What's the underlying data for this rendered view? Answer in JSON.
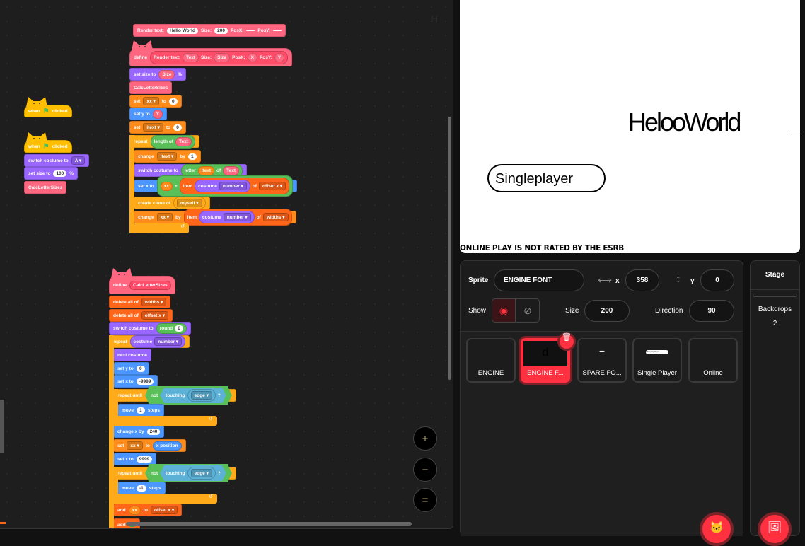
{
  "code": {
    "blocks": [
      {
        "c": "events",
        "hat": "cat",
        "p": [
          {
            "t": "when"
          },
          {
            "flag": true
          },
          {
            "t": "clicked"
          }
        ]
      },
      {
        "c": "events",
        "hat": "cat",
        "p": [
          {
            "t": "when"
          },
          {
            "flag": true
          },
          {
            "t": "clicked"
          }
        ]
      },
      {
        "c": "looks",
        "p": [
          {
            "t": "switch costume to"
          },
          {
            "d": "A"
          }
        ]
      },
      {
        "c": "looks",
        "p": [
          {
            "t": "set size to"
          },
          {
            "n": "100"
          },
          {
            "t": "%"
          }
        ]
      },
      {
        "c": "custom",
        "p": [
          {
            "t": "CalcLetterSizes"
          }
        ]
      },
      {
        "c": "custom",
        "p": [
          {
            "t": "Render text:"
          },
          {
            "n": "Hello World"
          },
          {
            "t": "Size:"
          },
          {
            "n": "200"
          },
          {
            "t": "PosX:"
          },
          {
            "n": ""
          },
          {
            "t": "PosY:"
          },
          {
            "n": ""
          }
        ]
      },
      {
        "c": "define",
        "hat": "cat",
        "p": [
          {
            "t": "define"
          },
          {
            "r": [
              {
                "t": "Render text:"
              },
              {
                "r": "Text",
                "c": "custom"
              },
              {
                "t": "Size:"
              },
              {
                "r": "Size",
                "c": "custom"
              },
              {
                "t": "PosX:"
              },
              {
                "r": "X",
                "c": "custom"
              },
              {
                "t": "PosY:"
              },
              {
                "r": "Y",
                "c": "custom"
              }
            ],
            "c": "proto"
          }
        ]
      },
      {
        "c": "looks",
        "p": [
          {
            "t": "set size to"
          },
          {
            "r": "Size",
            "c": "custom"
          },
          {
            "t": "%"
          }
        ]
      },
      {
        "c": "custom",
        "p": [
          {
            "t": "CalcLetterSizes"
          }
        ]
      },
      {
        "c": "variables",
        "p": [
          {
            "t": "set"
          },
          {
            "d": "xx"
          },
          {
            "t": "to"
          },
          {
            "n": "0"
          }
        ]
      },
      {
        "c": "motion",
        "p": [
          {
            "t": "set y to"
          },
          {
            "r": "Y",
            "c": "custom"
          }
        ]
      },
      {
        "c": "variables",
        "p": [
          {
            "t": "set"
          },
          {
            "d": "itext"
          },
          {
            "t": "to"
          },
          {
            "n": "0"
          }
        ]
      },
      {
        "c": "control",
        "p": [
          {
            "t": "repeat"
          },
          {
            "r": [
              {
                "t": "length of"
              },
              {
                "r": "Text",
                "c": "custom"
              }
            ],
            "c": "operators"
          }
        ]
      },
      {
        "c": "variables",
        "p": [
          {
            "t": "change"
          },
          {
            "d": "itext"
          },
          {
            "t": "by"
          },
          {
            "n": "1"
          }
        ]
      },
      {
        "c": "looks",
        "p": [
          {
            "t": "switch costume to"
          },
          {
            "r": [
              {
                "t": "letter"
              },
              {
                "r": "itext",
                "c": "variables"
              },
              {
                "t": "of"
              },
              {
                "r": "Text",
                "c": "custom"
              }
            ],
            "c": "operators"
          }
        ]
      },
      {
        "c": "motion",
        "p": [
          {
            "t": "set x to"
          },
          {
            "r": [
              {
                "r": "xx",
                "c": "variables"
              },
              {
                "t": "+"
              },
              {
                "r": [
                  {
                    "t": "item"
                  },
                  {
                    "r": [
                      {
                        "t": "costume"
                      },
                      {
                        "d": "number"
                      }
                    ],
                    "c": "looks"
                  },
                  {
                    "t": "of"
                  },
                  {
                    "d": "offset x"
                  }
                ],
                "c": "lists"
              }
            ],
            "c": "operators"
          }
        ]
      },
      {
        "c": "control",
        "p": [
          {
            "t": "create clone of"
          },
          {
            "r": [
              {
                "d": "myself"
              }
            ],
            "c": "control"
          }
        ]
      },
      {
        "c": "variables",
        "p": [
          {
            "t": "change"
          },
          {
            "d": "xx"
          },
          {
            "t": "by"
          },
          {
            "r": [
              {
                "t": "item"
              },
              {
                "r": [
                  {
                    "t": "costume"
                  },
                  {
                    "d": "number"
                  }
                ],
                "c": "looks"
              },
              {
                "t": "of"
              },
              {
                "d": "widths"
              }
            ],
            "c": "lists"
          }
        ]
      },
      {
        "c": "define",
        "hat": "cat",
        "p": [
          {
            "t": "define"
          },
          {
            "r": [
              {
                "t": "CalcLetterSizes"
              }
            ],
            "c": "proto"
          }
        ]
      },
      {
        "c": "lists",
        "p": [
          {
            "t": "delete all of"
          },
          {
            "d": "widths"
          }
        ]
      },
      {
        "c": "lists",
        "p": [
          {
            "t": "delete all of"
          },
          {
            "d": "offset x"
          }
        ]
      },
      {
        "c": "looks",
        "p": [
          {
            "t": "switch costume to"
          },
          {
            "r": [
              {
                "t": "round"
              },
              {
                "n": "0"
              }
            ],
            "c": "operators"
          }
        ]
      },
      {
        "c": "control",
        "p": [
          {
            "t": "repeat"
          },
          {
            "r": [
              {
                "t": "costume"
              },
              {
                "d": "number"
              }
            ],
            "c": "looks"
          }
        ]
      },
      {
        "c": "looks",
        "p": [
          {
            "t": "next costume"
          }
        ]
      },
      {
        "c": "motion",
        "p": [
          {
            "t": "set y to"
          },
          {
            "n": "0"
          }
        ]
      },
      {
        "c": "motion",
        "p": [
          {
            "t": "set x to"
          },
          {
            "n": "-9999"
          }
        ]
      },
      {
        "c": "control",
        "p": [
          {
            "t": "repeat until"
          },
          {
            "b": [
              {
                "t": "not"
              },
              {
                "b": [
                  {
                    "t": "touching"
                  },
                  {
                    "r": [
                      {
                        "d": "edge"
                      }
                    ],
                    "c": "sensing"
                  },
                  {
                    "t": "?"
                  }
                ],
                "c": "sensing"
              }
            ],
            "c": "operators"
          }
        ]
      },
      {
        "c": "motion",
        "p": [
          {
            "t": "move"
          },
          {
            "n": "1"
          },
          {
            "t": "steps"
          }
        ]
      },
      {
        "c": "motion",
        "p": [
          {
            "t": "change x by"
          },
          {
            "n": "240"
          }
        ]
      },
      {
        "c": "variables",
        "p": [
          {
            "t": "set"
          },
          {
            "d": "xx"
          },
          {
            "t": "to"
          },
          {
            "r": "x position",
            "c": "motion"
          }
        ]
      },
      {
        "c": "motion",
        "p": [
          {
            "t": "set x to"
          },
          {
            "n": "9999"
          }
        ]
      },
      {
        "c": "control",
        "p": [
          {
            "t": "repeat until"
          },
          {
            "b": [
              {
                "t": "not"
              },
              {
                "b": [
                  {
                    "t": "touching"
                  },
                  {
                    "r": [
                      {
                        "d": "edge"
                      }
                    ],
                    "c": "sensing"
                  },
                  {
                    "t": "?"
                  }
                ],
                "c": "sensing"
              }
            ],
            "c": "operators"
          }
        ]
      },
      {
        "c": "motion",
        "p": [
          {
            "t": "move"
          },
          {
            "n": "-1"
          },
          {
            "t": "steps"
          }
        ]
      },
      {
        "c": "lists",
        "p": [
          {
            "t": "add"
          },
          {
            "r": "xx",
            "c": "variables"
          },
          {
            "t": "to"
          },
          {
            "d": "offset x"
          }
        ]
      },
      {
        "c": "lists",
        "p": [
          {
            "t": "add"
          },
          {
            "r": [
              {
                "t": "  "
              }
            ],
            "c": "operators"
          }
        ]
      }
    ],
    "loop_arrow": "↺",
    "zoom_in": "+",
    "zoom_out": "−",
    "zoom_reset": "="
  },
  "colors": {
    "events": "#ffbf00",
    "looks": "#9966ff",
    "custom": "#ff6680",
    "define": "#ff6680",
    "proto": "#ff4d6a",
    "variables": "#ff8c1a",
    "motion": "#4c97ff",
    "control": "#ffab19",
    "operators": "#59c059",
    "sensing": "#5cb1d6",
    "lists": "#ff661a",
    "accent": "#ff3040"
  },
  "stage": {
    "rendered_text": "HelooWorld",
    "button_label": "Singleplayer",
    "rating_notice": "ONLINE PLAY IS NOT RATED BY THE ESRB"
  },
  "sprite_info": {
    "sprite_label": "Sprite",
    "sprite_name": "ENGINE FONT",
    "x_label": "x",
    "x_value": "358",
    "y_label": "y",
    "y_value": "0",
    "show_label": "Show",
    "size_label": "Size",
    "size_value": "200",
    "direction_label": "Direction",
    "direction_value": "90"
  },
  "sprites": [
    {
      "name": "ENGINE",
      "thumb": ""
    },
    {
      "name": "ENGINE F...",
      "thumb": "d",
      "selected": true
    },
    {
      "name": "SPARE FO...",
      "thumb": "−"
    },
    {
      "name": "Single Player",
      "thumb": "Singleplayer"
    },
    {
      "name": "Online",
      "thumb": ""
    }
  ],
  "stage_panel": {
    "title": "Stage",
    "backdrops_label": "Backdrops",
    "backdrops_count": "2"
  }
}
